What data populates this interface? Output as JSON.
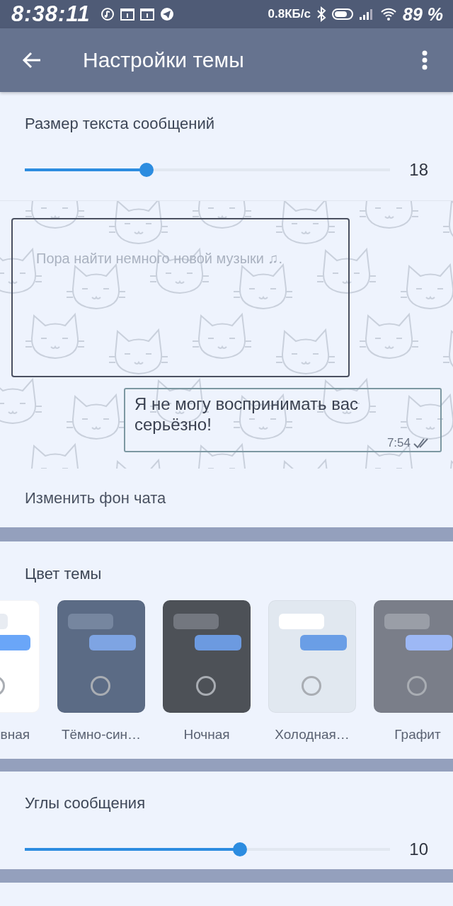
{
  "status_bar": {
    "time": "8:38:11",
    "speed": "0.8КБ/с",
    "battery": "89 %"
  },
  "app_bar": {
    "title": "Настройки темы"
  },
  "text_size": {
    "label": "Размер текста сообщений",
    "level": 0.333,
    "value": "18"
  },
  "chat_preview": {
    "incoming": {
      "text": "Пора найти немного новой музыки ♫."
    },
    "outgoing": {
      "text": "Я не могу воспринимать вас серьёзно!",
      "time": "7:54",
      "read": true
    }
  },
  "change_background": {
    "label": "Изменить фон чата"
  },
  "theme_color": {
    "title": "Цвет темы",
    "themes": [
      {
        "name": "вная",
        "color": "#ffffff",
        "incoming_bubble": {
          "color": "#e8ecf2"
        },
        "outgoing_bubble": {
          "color": "#6aa6f8"
        },
        "selected": false
      },
      {
        "name": "Тёмно-син…",
        "color": "#5b6b85",
        "incoming_bubble": {
          "color": "#76869f"
        },
        "outgoing_bubble": {
          "color": "#7ea4e3"
        },
        "selected": false
      },
      {
        "name": "Ночная",
        "color": "#4d5157",
        "incoming_bubble": {
          "color": "#73777f"
        },
        "outgoing_bubble": {
          "color": "#6c9ae0"
        },
        "selected": false
      },
      {
        "name": "Холодная…",
        "color": "#e1e8f0",
        "incoming_bubble": {
          "color": "#ffffff"
        },
        "outgoing_bubble": {
          "color": "#6a9ee6"
        },
        "selected": false
      },
      {
        "name": "Графит",
        "color": "#7a7e89",
        "incoming_bubble": {
          "color": "#9a9ea7"
        },
        "outgoing_bubble": {
          "color": "#9db8f5"
        },
        "selected": false
      }
    ]
  },
  "message_corners": {
    "label": "Углы сообщения",
    "level": 0.59,
    "value": "10"
  }
}
